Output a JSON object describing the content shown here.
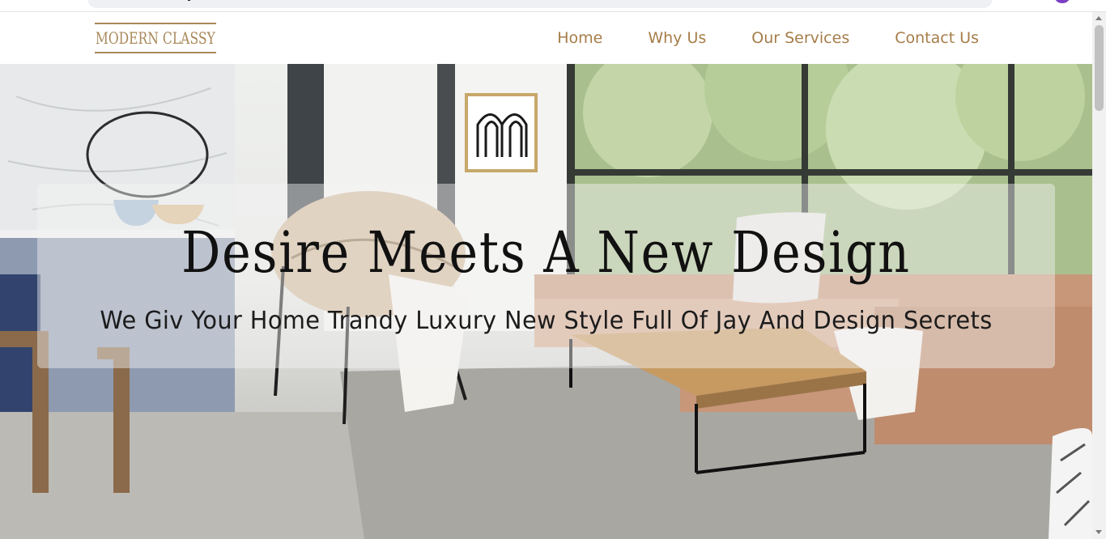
{
  "logo": {
    "text": "MODERN CLASSY"
  },
  "nav": {
    "items": [
      {
        "label": "Home"
      },
      {
        "label": "Why Us"
      },
      {
        "label": "Our Services"
      },
      {
        "label": "Contact Us"
      }
    ]
  },
  "hero": {
    "title": "Desire Meets A New Design",
    "subtitle": "We Giv Your Home Trandy Luxury New Style Full Of Jay And Design Secrets"
  },
  "colors": {
    "brand_gold": "#a9885a",
    "nav_text": "#a57d49",
    "hero_text": "#111111"
  }
}
